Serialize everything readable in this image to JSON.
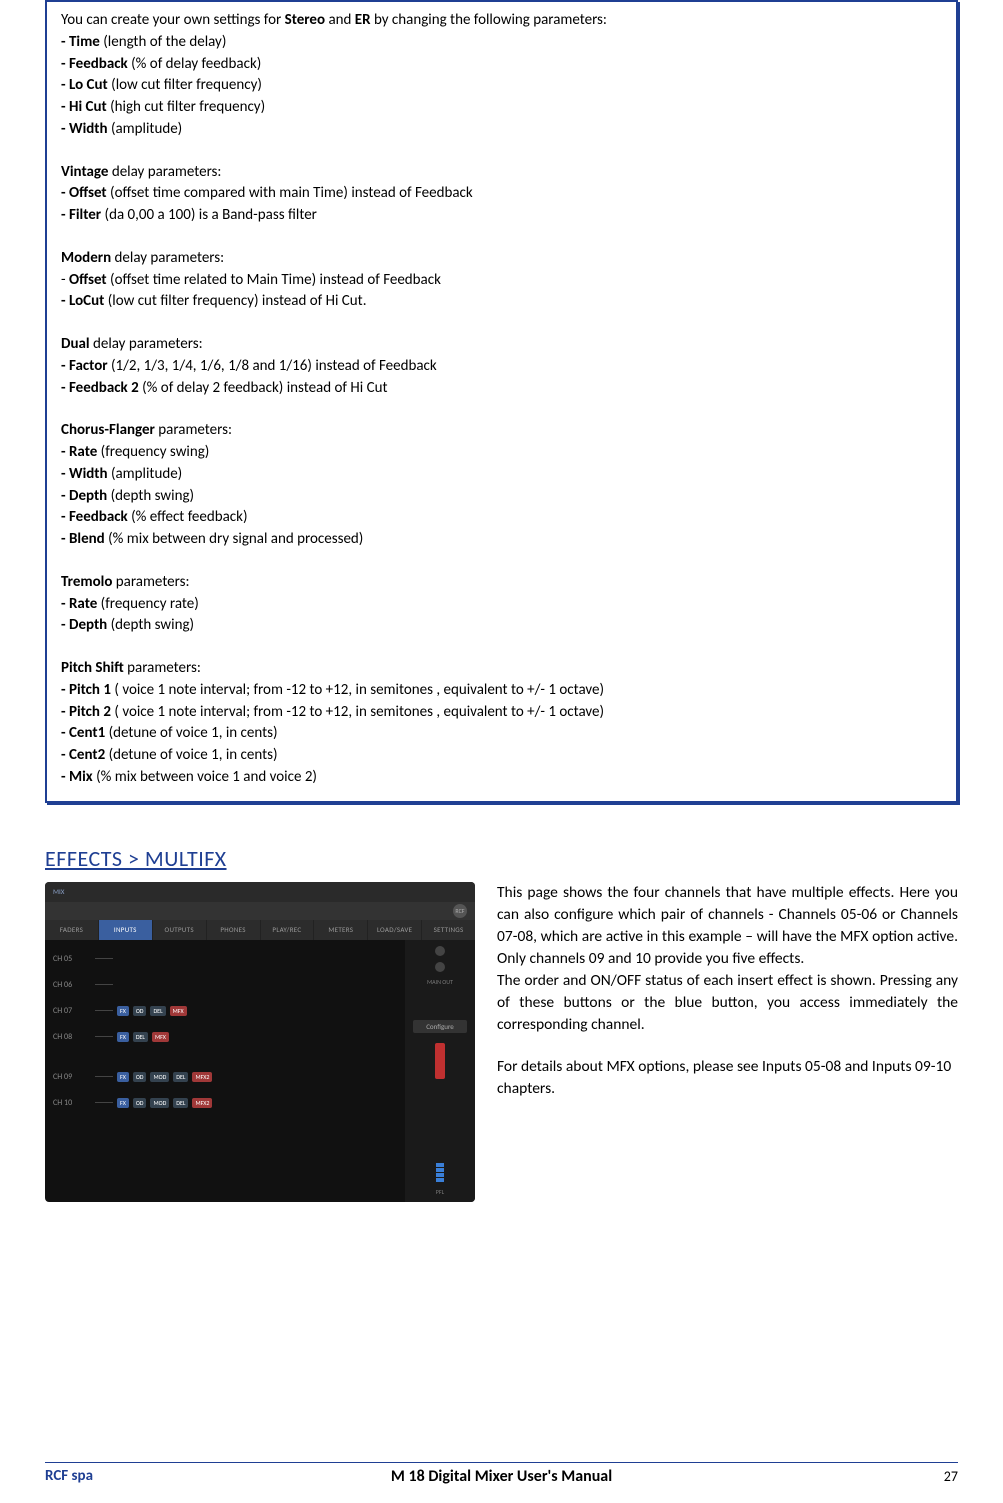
{
  "box": {
    "intro_prefix": "You can create your own settings for ",
    "intro_b1": "Stereo",
    "intro_mid": " and ",
    "intro_b2": "ER",
    "intro_suffix": " by changing the following parameters:",
    "p_time_b": "- Time",
    "p_time": " (length of the delay)",
    "p_feedback_b": "- Feedback",
    "p_feedback": " (% of delay feedback)",
    "p_locut_b": "- Lo Cut",
    "p_locut": " (low cut filter frequency)",
    "p_hicut_b": "- Hi Cut",
    "p_hicut": " (high cut filter frequency)",
    "p_width_b": "- Width",
    "p_width": " (amplitude)",
    "vintage_b": "Vintage",
    "vintage_t": " delay parameters:",
    "v_offset_b": "- Offset",
    "v_offset": " (offset time compared with main Time) instead of Feedback",
    "v_filter_b": "- Filter",
    "v_filter": " (da 0,00 a 100) is a Band-pass filter",
    "modern_b": "Modern",
    "modern_t": " delay parameters:",
    "m_offset_pre": "- ",
    "m_offset_b": "Offset",
    "m_offset": " (offset time related to Main Time) instead of Feedback",
    "m_locut_b": "- LoCut",
    "m_locut": " (low cut filter frequency) instead of Hi Cut.",
    "dual_b": "Dual",
    "dual_t": " delay parameters:",
    "d_factor_b": "- Factor",
    "d_factor": " (1/2, 1/3, 1/4, 1/6, 1/8 and 1/16) instead of Feedback",
    "d_fb2_b": "- Feedback 2",
    "d_fb2": " (% of delay 2 feedback) instead of Hi Cut",
    "cf_b": "Chorus-Flanger",
    "cf_t": " parameters:",
    "cf_rate_b": "- Rate",
    "cf_rate": " (frequency swing)",
    "cf_width_b": "- Width",
    "cf_width": " (amplitude)",
    "cf_depth_b": "- Depth",
    "cf_depth": " (depth swing)",
    "cf_fb_b": "- Feedback",
    "cf_fb": " (% effect feedback)",
    "cf_blend_b": "- Blend",
    "cf_blend": " (% mix between dry signal and processed)",
    "trem_b": "Tremolo",
    "trem_t": " parameters:",
    "t_rate_b": "- Rate",
    "t_rate": " (frequency rate)",
    "t_depth_b": "- Depth",
    "t_depth": " (depth swing)",
    "ps_b": "Pitch Shift",
    "ps_t": " parameters:",
    "ps1_b": "- Pitch 1",
    "ps1": " ( voice 1 note interval; from -12 to +12, in semitones , equivalent to +/- 1 octave)",
    "ps2_b": "- Pitch 2",
    "ps2": " ( voice 1 note interval; from -12 to +12, in semitones , equivalent to +/- 1 octave)",
    "c1_b": "- Cent1",
    "c1": " (detune of voice 1, in cents)",
    "c2_b": "- Cent2",
    "c2": " (detune of voice 1, in cents)",
    "mix_b": "- Mix",
    "mix": " (% mix between voice 1 and voice 2)"
  },
  "heading": "EFFECTS > MULTIFX",
  "shot": {
    "topbar_left": "MIX",
    "logo": "RCF",
    "tabs": [
      "FADERS",
      "INPUTS",
      "OUTPUTS",
      "PHONES",
      "PLAY/REC",
      "METERS",
      "LOAD/SAVE",
      "SETTINGS"
    ],
    "channels": [
      "CH 05",
      "CH 06",
      "CH 07",
      "CH 08",
      "CH 09",
      "CH 10"
    ],
    "chip_fx": "FX",
    "chip_od": "OD",
    "chip_mod": "MOD",
    "chip_del": "DEL",
    "chip_mfx": "MFX",
    "chip_mfx2": "MFX2",
    "side_mainout": "MAIN OUT",
    "side_configure": "Configure",
    "side_pfl": "PFL"
  },
  "desc": {
    "p1": "This page shows the four channels that have multiple effects. Here you can also configure which pair of channels - Channels 05-06 or Channels 07-08, which are active in this example – will have the MFX option active. Only channels 09 and 10 provide you five effects.",
    "p2": "The order and ON/OFF status of each insert effect is shown. Pressing any of these buttons or the blue button, you access immediately the corresponding channel.",
    "p3": "For details about MFX options, please see Inputs 05-08 and Inputs 09-10 chapters."
  },
  "footer": {
    "left": "RCF spa",
    "center": "M 18 Digital Mixer User's Manual",
    "page": "27"
  }
}
